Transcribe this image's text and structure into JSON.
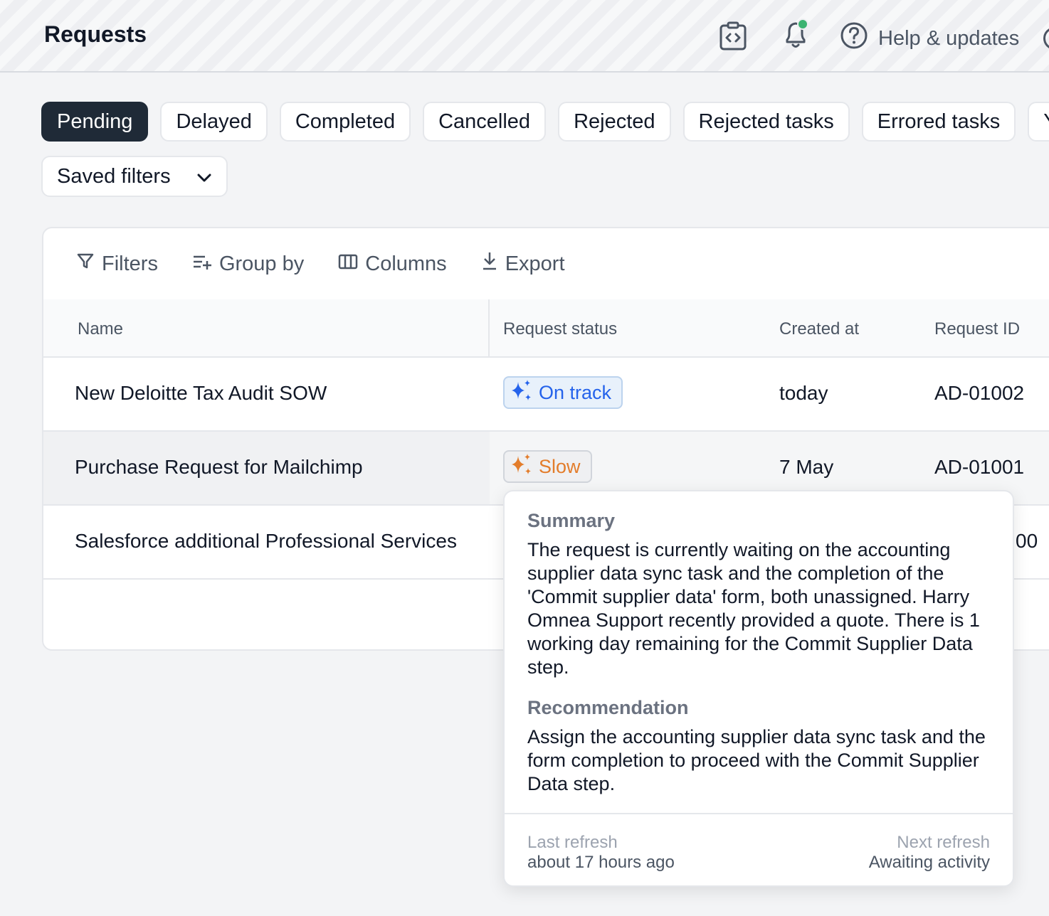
{
  "header": {
    "title": "Requests",
    "help_label": "Help & updates",
    "icons": [
      "code-clipboard-icon",
      "bell-icon",
      "help-circle-icon"
    ],
    "notification_dot_color": "#3cb371"
  },
  "tabs": [
    "Pending",
    "Delayed",
    "Completed",
    "Cancelled",
    "Rejected",
    "Rejected tasks",
    "Errored tasks",
    "Your"
  ],
  "active_tab": "Pending",
  "saved_filters": {
    "label": "Saved filters"
  },
  "toolbar": {
    "filters": "Filters",
    "group_by": "Group by",
    "columns": "Columns",
    "export": "Export"
  },
  "table": {
    "columns": [
      "Name",
      "Request status",
      "Created at",
      "Request ID"
    ],
    "rows": [
      {
        "name": "New Deloitte Tax Audit SOW",
        "status": "On track",
        "created": "today",
        "id": "AD-01002"
      },
      {
        "name": "Purchase Request for Mailchimp",
        "status": "Slow",
        "created": "7 May",
        "id": "AD-01001"
      },
      {
        "name": "Salesforce additional Professional Services",
        "status": "",
        "created": "",
        "id": "00"
      }
    ]
  },
  "popover": {
    "summary_title": "Summary",
    "summary_text": "The request is currently waiting on the accounting supplier data sync task and the completion of the 'Commit supplier data' form, both unassigned. Harry Omnea Support recently provided a quote. There is 1 working day remaining for the Commit Supplier Data step.",
    "recommendation_title": "Recommendation",
    "recommendation_text": "Assign the accounting supplier data sync task and the form completion to proceed with the Commit Supplier Data step.",
    "last_refresh_label": "Last refresh",
    "last_refresh_value": "about 17 hours ago",
    "next_refresh_label": "Next refresh",
    "next_refresh_value": "Awaiting activity"
  },
  "colors": {
    "active_tab_bg": "#1f2a37",
    "on_track": "#2563eb",
    "slow": "#e37d2b"
  }
}
